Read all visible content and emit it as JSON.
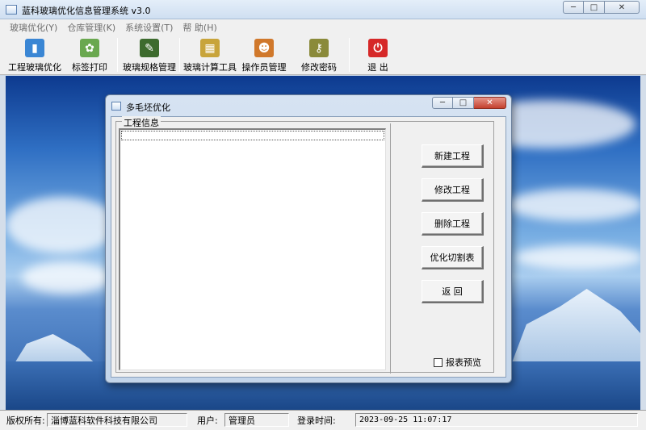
{
  "window": {
    "title": "蓝科玻璃优化信息管理系统 v3.0",
    "min_glyph": "─",
    "max_glyph": "□",
    "close_glyph": "✕"
  },
  "menu": [
    "玻璃优化(Y)",
    "仓库管理(K)",
    "系统设置(T)",
    "帮 助(H)"
  ],
  "toolbar": {
    "items": [
      {
        "label": "工程玻璃优化",
        "icon": "book-icon",
        "color": "#3a86d4"
      },
      {
        "label": "标签打印",
        "icon": "document-icon",
        "color": "#6aa84f"
      },
      {
        "label": "玻璃规格管理",
        "icon": "edit-icon",
        "color": "#3d6b2e"
      },
      {
        "label": "玻璃计算工具",
        "icon": "calculator-icon",
        "color": "#c8a43a"
      },
      {
        "label": "操作员管理",
        "icon": "users-icon",
        "color": "#d0782b"
      },
      {
        "label": "修改密码",
        "icon": "key-icon",
        "color": "#8a8a3a"
      },
      {
        "label": "退 出",
        "icon": "power-icon",
        "color": "#d62828"
      }
    ]
  },
  "dialog": {
    "title": "多毛坯优化",
    "group_label": "工程信息",
    "buttons": [
      "新建工程",
      "修改工程",
      "删除工程",
      "优化切割表",
      "返 回"
    ],
    "checkbox_label": "报表预览",
    "checkbox_checked": false
  },
  "status": {
    "copyright_label": "版权所有:",
    "company": "淄博蓝科软件科技有限公司",
    "user_label": "用户:",
    "user": "管理员",
    "login_label": "登录时间:",
    "login_time": "2023-09-25  11:07:17"
  }
}
